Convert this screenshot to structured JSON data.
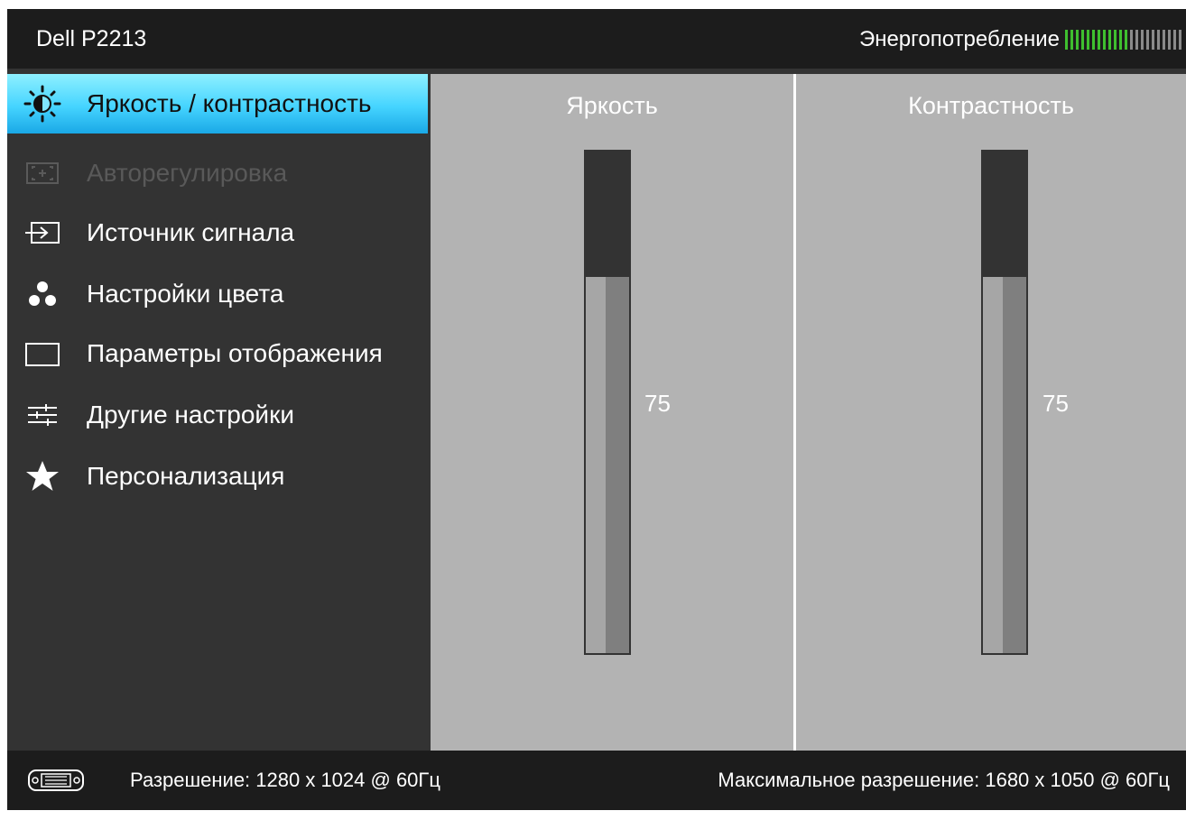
{
  "header": {
    "title": "Dell P2213",
    "energy_label": "Энергопотребление",
    "energy_level": 0.55
  },
  "menu": {
    "items": [
      {
        "label": "Яркость / контрастность",
        "icon": "brightness-contrast-icon",
        "state": "selected"
      },
      {
        "label": "Авторегулировка",
        "icon": "auto-adjust-icon",
        "state": "disabled"
      },
      {
        "label": "Источник сигнала",
        "icon": "input-source-icon",
        "state": "normal"
      },
      {
        "label": "Настройки цвета",
        "icon": "color-settings-icon",
        "state": "normal"
      },
      {
        "label": "Параметры отображения",
        "icon": "display-settings-icon",
        "state": "normal"
      },
      {
        "label": "Другие настройки",
        "icon": "other-settings-icon",
        "state": "normal"
      },
      {
        "label": "Персонализация",
        "icon": "star-icon",
        "state": "normal"
      }
    ]
  },
  "brightness": {
    "label": "Яркость",
    "value": "75",
    "level": 0.75
  },
  "contrast": {
    "label": "Контрастность",
    "value": "75",
    "level": 0.75
  },
  "footer": {
    "resolution": "Разрешение: 1280 x 1024 @ 60Гц",
    "max_resolution": "Максимальное разрешение: 1680 x 1050 @ 60Гц",
    "connector_icon": "dvi-connector-icon"
  },
  "colors": {
    "selected_gradient_top": "#8ef0ff",
    "selected_gradient_bottom": "#1aa8e6",
    "energy_on": "#3fbf2f",
    "energy_off": "#8a8a8a",
    "panel_bg": "#333333",
    "content_bg": "#b3b3b3"
  }
}
